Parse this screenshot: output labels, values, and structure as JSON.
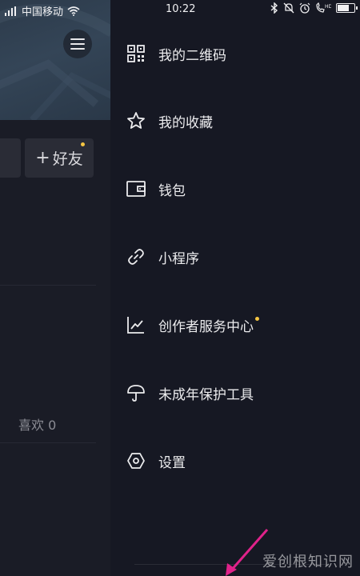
{
  "status_bar": {
    "carrier": "中国移动",
    "time": "10:22"
  },
  "profile_background": {
    "add_friend_label": "好友",
    "likes_tab": "喜欢 0"
  },
  "drawer": {
    "items": [
      {
        "label": "我的二维码",
        "icon": "qr-code-icon"
      },
      {
        "label": "我的收藏",
        "icon": "star-icon"
      },
      {
        "label": "钱包",
        "icon": "wallet-icon"
      },
      {
        "label": "小程序",
        "icon": "link-icon"
      },
      {
        "label": "创作者服务中心",
        "icon": "chart-icon",
        "badge": true
      },
      {
        "label": "未成年保护工具",
        "icon": "umbrella-icon"
      },
      {
        "label": "设置",
        "icon": "settings-hex-icon"
      }
    ]
  },
  "watermark": "爱创根知识网",
  "colors": {
    "background": "#161823",
    "badge": "#f5c542",
    "arrow": "#e0228a"
  }
}
